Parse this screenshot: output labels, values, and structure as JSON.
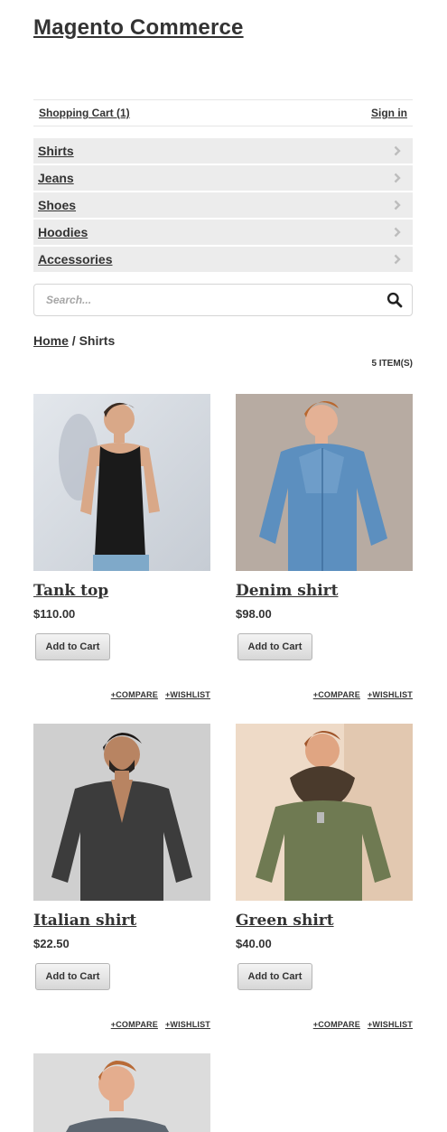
{
  "header": {
    "title": "Magento Commerce"
  },
  "account": {
    "cart": "Shopping Cart (1)",
    "signin": "Sign in"
  },
  "nav": {
    "items": [
      "Shirts",
      "Jeans",
      "Shoes",
      "Hoodies",
      "Accessories"
    ]
  },
  "search": {
    "placeholder": "Search..."
  },
  "breadcrumb": {
    "home": "Home",
    "separator": "/",
    "current": "Shirts"
  },
  "listing": {
    "count": "5 ITEM(S)"
  },
  "products": [
    {
      "name": "Tank top",
      "price": "$110.00",
      "cart": "Add to Cart",
      "compare": "+COMPARE",
      "wishlist": "+WISHLIST"
    },
    {
      "name": "Denim shirt",
      "price": "$98.00",
      "cart": "Add to Cart",
      "compare": "+COMPARE",
      "wishlist": "+WISHLIST"
    },
    {
      "name": "Italian shirt",
      "price": "$22.50",
      "cart": "Add to Cart",
      "compare": "+COMPARE",
      "wishlist": "+WISHLIST"
    },
    {
      "name": "Green shirt",
      "price": "$40.00",
      "cart": "Add to Cart",
      "compare": "+COMPARE",
      "wishlist": "+WISHLIST"
    },
    {
      "name": "",
      "price": "",
      "cart": "",
      "compare": "",
      "wishlist": ""
    }
  ],
  "icons": {
    "search": "search-icon",
    "chevron": "chevron-right-icon"
  },
  "colors": {
    "nav_bg": "#ececec",
    "text": "#333333"
  }
}
